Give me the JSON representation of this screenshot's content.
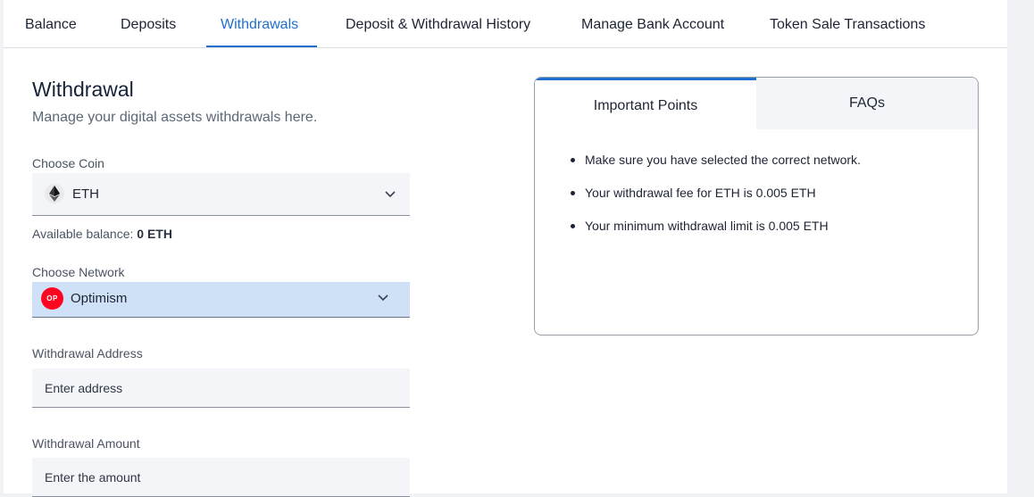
{
  "tabs": [
    {
      "label": "Balance"
    },
    {
      "label": "Deposits"
    },
    {
      "label": "Withdrawals",
      "active": true
    },
    {
      "label": "Deposit & Withdrawal History"
    },
    {
      "label": "Manage Bank Account"
    },
    {
      "label": "Token Sale Transactions"
    }
  ],
  "withdrawal": {
    "title": "Withdrawal",
    "subtitle": "Manage your digital assets withdrawals here.",
    "coin_label": "Choose Coin",
    "coin_value": "ETH",
    "coin_icon": "ethereum-icon",
    "balance_label": "Available balance:",
    "balance_value": "0 ETH",
    "network_label": "Choose Network",
    "network_value": "Optimism",
    "network_icon_text": "OP",
    "address_label": "Withdrawal Address",
    "address_placeholder": "Enter address",
    "amount_label": "Withdrawal Amount",
    "amount_placeholder": "Enter the amount"
  },
  "info_panel": {
    "tabs": [
      {
        "label": "Important Points",
        "active": true
      },
      {
        "label": "FAQs"
      }
    ],
    "points": [
      "Make sure you have selected the correct network.",
      "Your withdrawal fee for ETH is 0.005 ETH",
      "Your minimum withdrawal limit is 0.005 ETH"
    ]
  },
  "colors": {
    "accent": "#1f6fcf",
    "selected_field_bg": "#cfe1f7",
    "optimism_red": "#ff0420"
  }
}
